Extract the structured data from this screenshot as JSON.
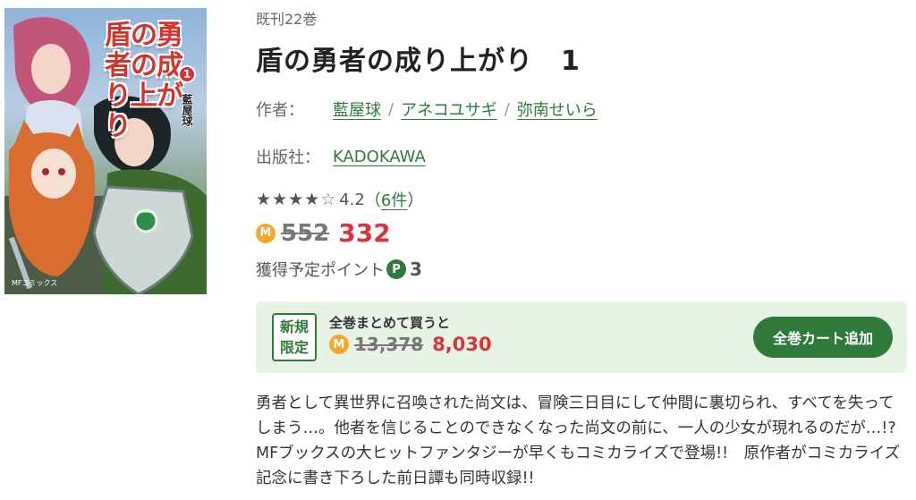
{
  "cover": {
    "title": "盾の勇者の成り上がり",
    "volume": "1",
    "author": "藍屋球",
    "imprint": "MFコミックス"
  },
  "book": {
    "series_count": "既刊22巻",
    "title": "盾の勇者の成り上がり　1",
    "author_label": "作者：",
    "authors": [
      "藍屋球",
      "アネコユサギ",
      "弥南せいら"
    ],
    "author_separator": "/",
    "publisher_label": "出版社：",
    "publisher": "KADOKAWA",
    "rating": {
      "value": "4.2",
      "stars_filled": 4,
      "stars_total": 5,
      "open_paren": "（",
      "count": "6件",
      "close_paren": "）"
    },
    "price": {
      "coin_icon": "M",
      "original": "552",
      "current": "332"
    },
    "points": {
      "label": "獲得予定ポイント",
      "badge": "P",
      "value": "3"
    }
  },
  "bundle": {
    "badge_line1": "新規",
    "badge_line2": "限定",
    "label": "全巻まとめて買うと",
    "coin_icon": "M",
    "original": "13,378",
    "current": "8,030",
    "button_label": "全巻カート追加"
  },
  "description": "勇者として異世界に召喚された尚文は、冒険三日目にして仲間に裏切られ、すべてを失ってしまう…。他者を信じることのできなくなった尚文の前に、一人の少女が現れるのだが…!?　MFブックスの大ヒットファンタジーが早くもコミカライズで登場!!　原作者がコミカライズ記念に書き下ろした前日譚も同時収録!!",
  "colors": {
    "accent_green": "#2f7a3b",
    "price_red": "#d8343a",
    "bundle_bg": "#e7f4e5",
    "coin_orange": "#f0a92b"
  }
}
